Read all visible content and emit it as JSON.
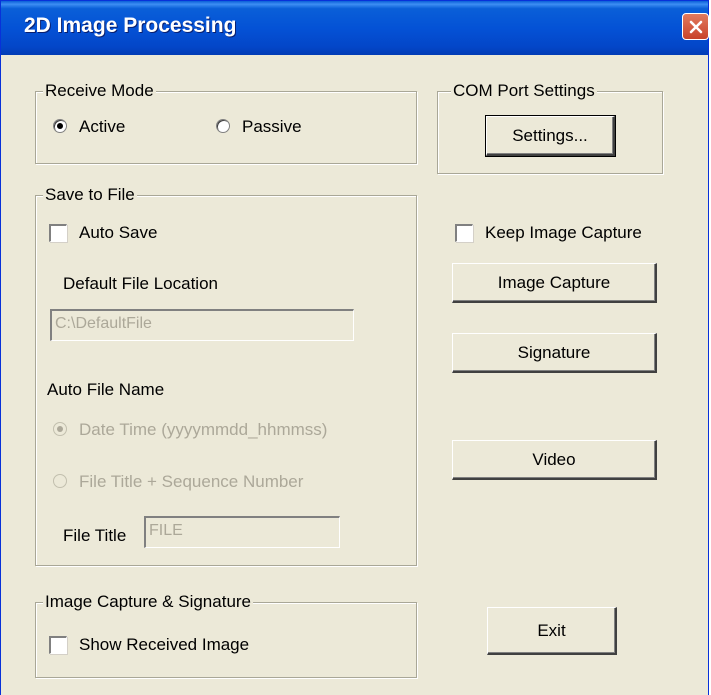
{
  "window": {
    "title": "2D Image Processing",
    "close_icon": "close-icon"
  },
  "receive_mode": {
    "legend": "Receive Mode",
    "active_label": "Active",
    "passive_label": "Passive",
    "selected": "Active"
  },
  "com_port": {
    "legend": "COM Port Settings",
    "settings_button": "Settings..."
  },
  "save_to_file": {
    "legend": "Save to File",
    "auto_save_label": "Auto Save",
    "default_location_label": "Default File Location",
    "default_location_value": "C:\\DefaultFile",
    "auto_file_name_label": "Auto File Name",
    "date_time_label": "Date Time (yyyymmdd_hhmmss)",
    "file_title_seq_label": "File Title + Sequence Number",
    "file_title_label": "File Title",
    "file_title_value": "FILE"
  },
  "capture": {
    "keep_capture_label": "Keep Image Capture",
    "image_capture_button": "Image Capture",
    "signature_button": "Signature",
    "video_button": "Video"
  },
  "image_capture_signature": {
    "legend": "Image Capture & Signature",
    "show_received_label": "Show Received Image"
  },
  "exit_button": "Exit"
}
